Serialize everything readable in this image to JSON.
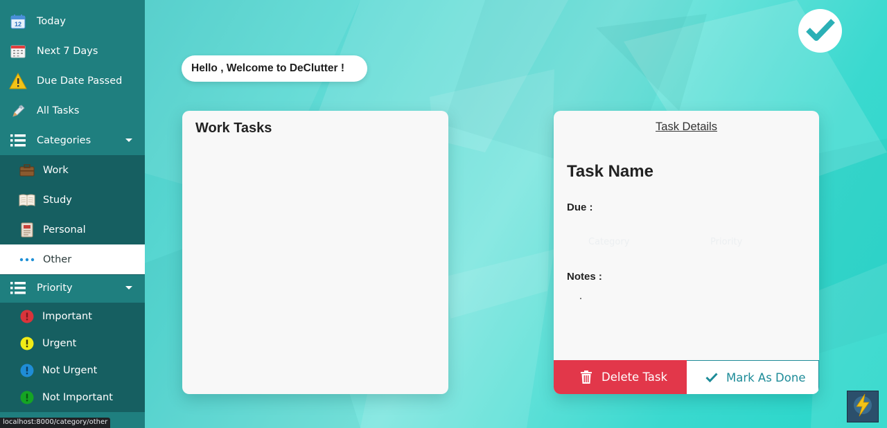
{
  "sidebar": {
    "items": [
      {
        "label": "Today",
        "icon": "calendar-12-icon"
      },
      {
        "label": "Next 7 Days",
        "icon": "calendar-grid-icon"
      },
      {
        "label": "Due Date Passed",
        "icon": "warning-icon"
      },
      {
        "label": "All Tasks",
        "icon": "pen-icon"
      },
      {
        "label": "Categories",
        "icon": "list-icon"
      }
    ],
    "categories": [
      {
        "label": "Work",
        "icon": "briefcase-icon"
      },
      {
        "label": "Study",
        "icon": "book-icon"
      },
      {
        "label": "Personal",
        "icon": "notebook-icon"
      },
      {
        "label": "Other",
        "icon": "dots-icon"
      }
    ],
    "priority_header": {
      "label": "Priority",
      "icon": "list-icon"
    },
    "priorities": [
      {
        "label": "Important",
        "color": "#d9343b"
      },
      {
        "label": "Urgent",
        "color": "#f1ec16"
      },
      {
        "label": "Not Urgent",
        "color": "#1f8dd6"
      },
      {
        "label": "Not Important",
        "color": "#15a424"
      }
    ]
  },
  "greeting": "Hello , Welcome to DeClutter !",
  "tasks_panel": {
    "title": "Work Tasks"
  },
  "details": {
    "header": "Task Details",
    "task_name": "Task Name",
    "due_label": "Due :",
    "category_placeholder": "Category",
    "priority_placeholder": "Priority",
    "notes_label": "Notes :",
    "delete_label": "Delete Task",
    "done_label": "Mark As Done"
  },
  "status_url": "localhost:8000/category/other",
  "colors": {
    "sidebar": "#1f7f7f",
    "sidebar_sub": "#165f61",
    "delete": "#e2374a",
    "done_text": "#1d8b98"
  }
}
